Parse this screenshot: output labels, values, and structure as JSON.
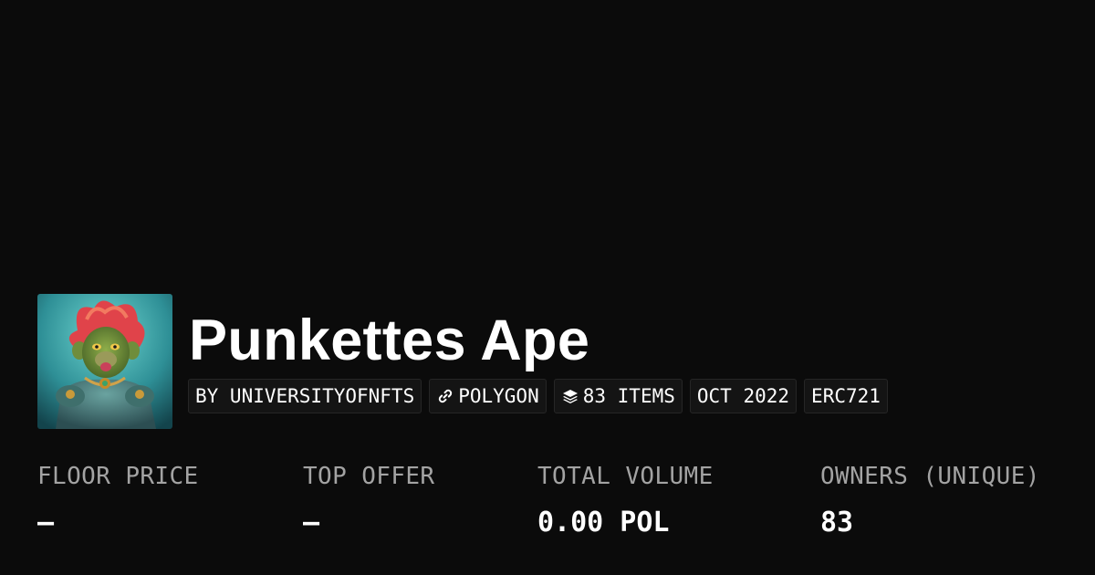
{
  "collection": {
    "name": "Punkettes Ape",
    "avatar_icon": "ape-portrait-image"
  },
  "tags": [
    {
      "label": "BY UNIVERSITYOFNFTS",
      "icon": null
    },
    {
      "label": "POLYGON",
      "icon": "chain-link-icon"
    },
    {
      "label": "83 ITEMS",
      "icon": "layers-icon"
    },
    {
      "label": "OCT 2022",
      "icon": null
    },
    {
      "label": "ERC721",
      "icon": null
    }
  ],
  "stats": [
    {
      "label": "FLOOR PRICE",
      "value": "–"
    },
    {
      "label": "TOP OFFER",
      "value": "–"
    },
    {
      "label": "TOTAL VOLUME",
      "value": "0.00 POL"
    },
    {
      "label": "OWNERS (UNIQUE)",
      "value": "83"
    }
  ],
  "colors": {
    "background": "#0b0b0b",
    "text": "#ffffff",
    "muted_label": "#a3a3a3",
    "tag_background": "#141414",
    "tag_border": "#262626"
  }
}
